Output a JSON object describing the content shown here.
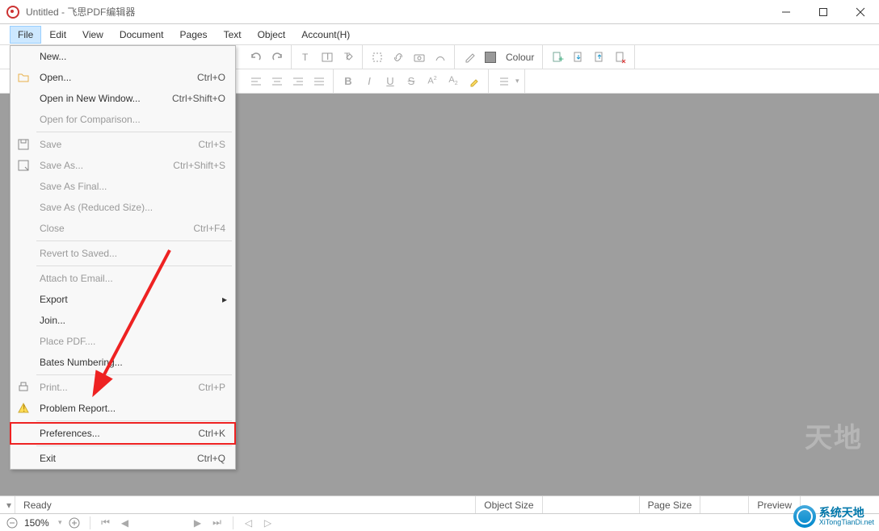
{
  "window": {
    "title": "Untitled - 飞思PDF编辑器"
  },
  "menubar": {
    "items": [
      "File",
      "Edit",
      "View",
      "Document",
      "Pages",
      "Text",
      "Object",
      "Account(H)"
    ]
  },
  "toolbar2": {
    "colour_label": "Colour"
  },
  "file_menu": {
    "items": [
      {
        "label": "New...",
        "shortcut": "",
        "enabled": true
      },
      {
        "label": "Open...",
        "shortcut": "Ctrl+O",
        "enabled": true,
        "icon": "folder"
      },
      {
        "label": "Open in New Window...",
        "shortcut": "Ctrl+Shift+O",
        "enabled": true
      },
      {
        "label": "Open for Comparison...",
        "shortcut": "",
        "enabled": false
      },
      {
        "sep": true
      },
      {
        "label": "Save",
        "shortcut": "Ctrl+S",
        "enabled": false,
        "icon": "save"
      },
      {
        "label": "Save As...",
        "shortcut": "Ctrl+Shift+S",
        "enabled": false,
        "icon": "saveas"
      },
      {
        "label": "Save As Final...",
        "shortcut": "",
        "enabled": false
      },
      {
        "label": "Save As (Reduced Size)...",
        "shortcut": "",
        "enabled": false
      },
      {
        "label": "Close",
        "shortcut": "Ctrl+F4",
        "enabled": false
      },
      {
        "sep": true
      },
      {
        "label": "Revert to Saved...",
        "shortcut": "",
        "enabled": false
      },
      {
        "sep": true
      },
      {
        "label": "Attach to Email...",
        "shortcut": "",
        "enabled": false
      },
      {
        "label": "Export",
        "shortcut": "",
        "enabled": true,
        "submenu": true
      },
      {
        "label": "Join...",
        "shortcut": "",
        "enabled": true
      },
      {
        "label": "Place PDF....",
        "shortcut": "",
        "enabled": false
      },
      {
        "label": "Bates Numbering...",
        "shortcut": "",
        "enabled": true
      },
      {
        "sep": true
      },
      {
        "label": "Print...",
        "shortcut": "Ctrl+P",
        "enabled": false,
        "icon": "print"
      },
      {
        "label": "Problem Report...",
        "shortcut": "",
        "enabled": true,
        "icon": "warn"
      },
      {
        "sep": true
      },
      {
        "label": "Preferences...",
        "shortcut": "Ctrl+K",
        "enabled": true,
        "highlight": true
      },
      {
        "sep": true
      },
      {
        "label": "Exit",
        "shortcut": "Ctrl+Q",
        "enabled": true
      }
    ]
  },
  "status": {
    "ready": "Ready",
    "object_size": "Object Size",
    "page_size": "Page Size",
    "preview": "Preview"
  },
  "nav": {
    "zoom": "150%"
  },
  "watermark": {
    "line1": "系统天地",
    "line2": "XiTongTianDi.net",
    "ghost": "天地"
  }
}
